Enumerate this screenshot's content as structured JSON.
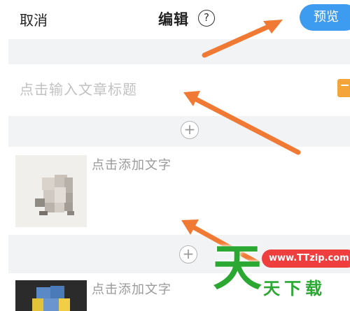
{
  "header": {
    "cancel_label": "取消",
    "title": "编辑",
    "help_glyph": "?",
    "preview_label": "预览"
  },
  "title_input": {
    "placeholder": "点击输入文章标题"
  },
  "blocks": [
    {
      "add_text_label": "点击添加文字"
    },
    {
      "add_text_label": "点击添加文字"
    }
  ],
  "plus_glyph": "+",
  "watermark": {
    "big_char": "天",
    "url": "www.TTzip.com",
    "site_name": "天下载"
  },
  "colors": {
    "preview_button": "#3e9cf0",
    "arrow": "#f07a34",
    "watermark_green": "#2aa832",
    "watermark_red": "#ee3e3e",
    "gray_band": "#f2f3f5"
  },
  "icons": [
    "help-circle-icon",
    "plus-circle-icon",
    "orange-arrow-icon"
  ]
}
